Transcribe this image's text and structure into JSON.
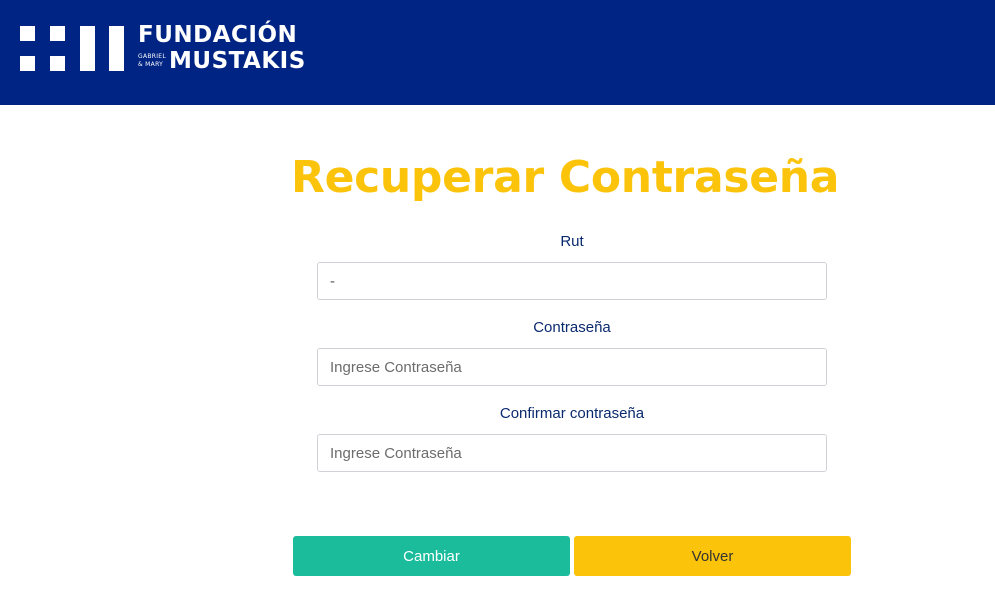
{
  "header": {
    "logo": {
      "icon": "fundacion-mustakis-logo-mark",
      "line1": "FUNDACIÓN",
      "small_top": "GABRIEL",
      "small_bottom": "& MARY",
      "line2": "MUSTAKIS"
    },
    "background_color": "#002484"
  },
  "page": {
    "title": "Recuperar Contraseña",
    "title_color": "#fcc30b"
  },
  "form": {
    "rut": {
      "label": "Rut",
      "value": "-",
      "placeholder": ""
    },
    "password": {
      "label": "Contraseña",
      "value": "",
      "placeholder": "Ingrese Contraseña"
    },
    "confirm_password": {
      "label": "Confirmar contraseña",
      "value": "",
      "placeholder": "Ingrese Contraseña"
    }
  },
  "actions": {
    "change_label": "Cambiar",
    "change_color": "#1abc9c",
    "back_label": "Volver",
    "back_color": "#fcc30b"
  }
}
